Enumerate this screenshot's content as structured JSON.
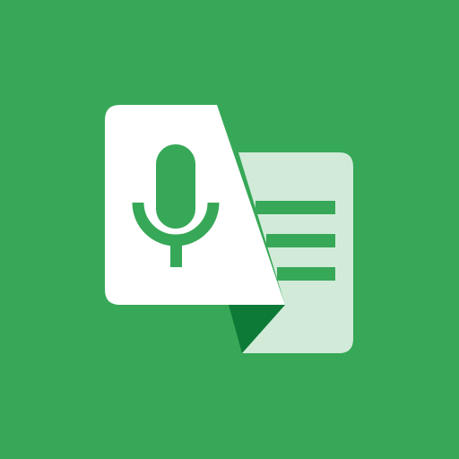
{
  "icon": {
    "name": "speech-to-text-app-icon",
    "colors": {
      "background": "#37A857",
      "voice_card": "#FFFFFF",
      "microphone": "#37A857",
      "text_card": "#D2EBD9",
      "text_lines": "#37A857",
      "fold": "#0E7A37"
    }
  }
}
